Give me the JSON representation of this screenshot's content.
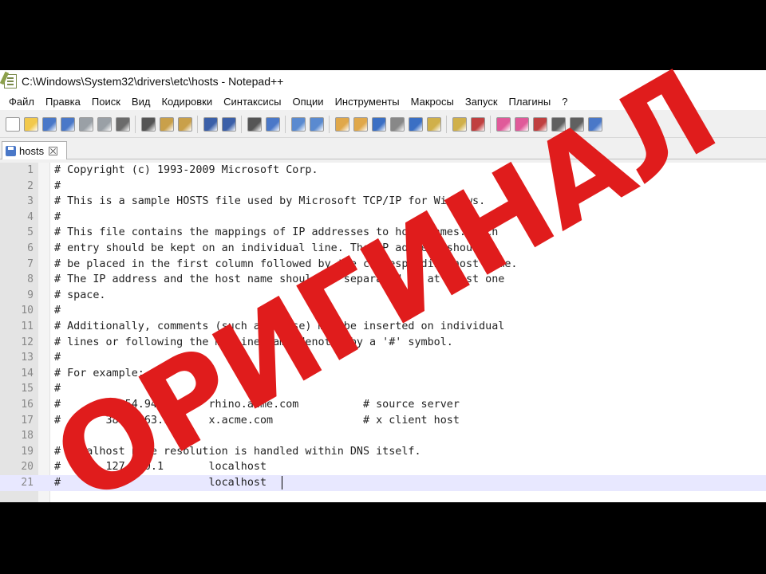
{
  "window": {
    "title": "C:\\Windows\\System32\\drivers\\etc\\hosts - Notepad++"
  },
  "menu": {
    "items": [
      "Файл",
      "Правка",
      "Поиск",
      "Вид",
      "Кодировки",
      "Синтаксисы",
      "Опции",
      "Инструменты",
      "Макросы",
      "Запуск",
      "Плагины",
      "?"
    ]
  },
  "toolbar": {
    "icons": [
      "new-file-icon",
      "open-file-icon",
      "save-icon",
      "save-all-icon",
      "close-icon",
      "close-all-icon",
      "print-icon",
      "cut-icon",
      "copy-icon",
      "paste-icon",
      "undo-icon",
      "redo-icon",
      "find-icon",
      "replace-icon",
      "zoom-in-icon",
      "zoom-out-icon",
      "sync-vertical-icon",
      "sync-horizontal-icon",
      "word-wrap-icon",
      "show-all-chars-icon",
      "indent-guide-icon",
      "document-map-icon",
      "function-list-icon",
      "folder-workspace-icon",
      "monitoring-icon",
      "record-macro-icon",
      "stop-record-icon",
      "play-macro-icon",
      "run-macro-icon",
      "save-macro-icon"
    ]
  },
  "tabs": [
    {
      "label": "hosts",
      "active": true
    }
  ],
  "editor": {
    "current_line": 21,
    "lines": [
      {
        "n": "1",
        "text": "# Copyright (c) 1993-2009 Microsoft Corp."
      },
      {
        "n": "2",
        "text": "#"
      },
      {
        "n": "3",
        "text": "# This is a sample HOSTS file used by Microsoft TCP/IP for Windows."
      },
      {
        "n": "4",
        "text": "#"
      },
      {
        "n": "5",
        "text": "# This file contains the mappings of IP addresses to host names. Each"
      },
      {
        "n": "6",
        "text": "# entry should be kept on an individual line. The IP address should"
      },
      {
        "n": "7",
        "text": "# be placed in the first column followed by the corresponding host name."
      },
      {
        "n": "8",
        "text": "# The IP address and the host name should be separated by at least one"
      },
      {
        "n": "9",
        "text": "# space."
      },
      {
        "n": "10",
        "text": "#"
      },
      {
        "n": "11",
        "text": "# Additionally, comments (such as these) may be inserted on individual"
      },
      {
        "n": "12",
        "text": "# lines or following the machine name denoted by a '#' symbol."
      },
      {
        "n": "13",
        "text": "#"
      },
      {
        "n": "14",
        "text": "# For example:"
      },
      {
        "n": "15",
        "text": "#"
      },
      {
        "n": "16",
        "text": "#      102.54.94.97     rhino.acme.com          # source server"
      },
      {
        "n": "17",
        "text": "#       38.25.63.10     x.acme.com              # x client host"
      },
      {
        "n": "18",
        "text": ""
      },
      {
        "n": "19",
        "text": "# localhost name resolution is handled within DNS itself."
      },
      {
        "n": "20",
        "text": "#\t127.0.0.1       localhost"
      },
      {
        "n": "21",
        "text": "#\t::1             localhost"
      }
    ]
  },
  "overlay": {
    "stamp_text": "ОРИГИНАЛ",
    "stamp_color": "#e01c1c"
  },
  "colors": {
    "gutter": "#e4e4e4",
    "current_line": "#e8e8ff",
    "text": "#222222"
  }
}
